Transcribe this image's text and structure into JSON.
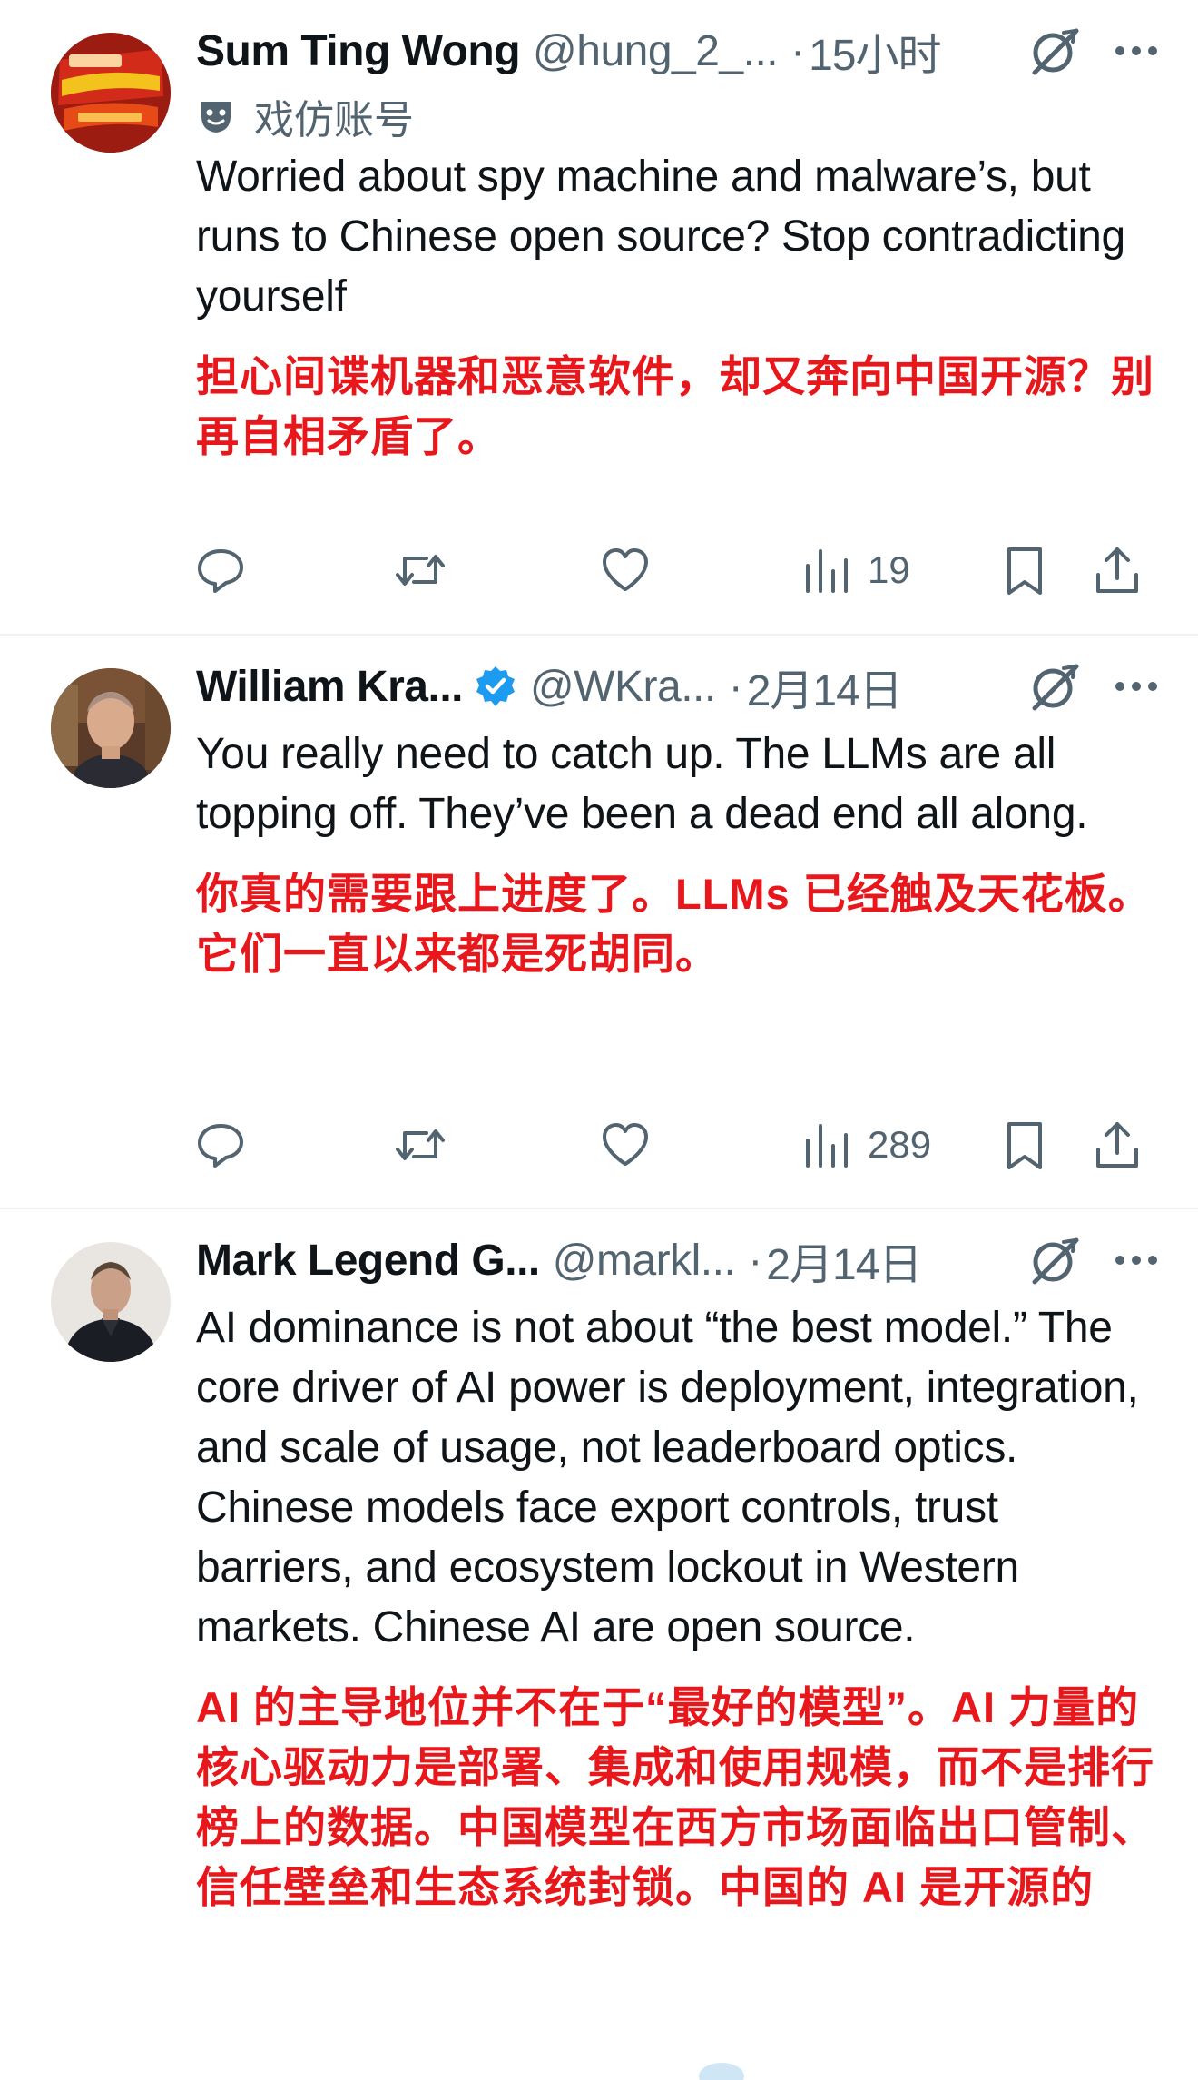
{
  "tweets": [
    {
      "name": "Sum Ting Wong",
      "handle": "@hung_2_...",
      "separator": "·",
      "time": "15小时",
      "verified": false,
      "parody_label": "戏仿账号",
      "text_en": "Worried about spy machine and malware’s, but runs to Chinese open source? Stop contradicting yourself",
      "text_zh": "担心间谍机器和恶意软件，却又奔向中国开源？别再自相矛盾了。",
      "views": "19"
    },
    {
      "name": "William Kra...",
      "handle": "@WKra...",
      "separator": "·",
      "time": "2月14日",
      "verified": true,
      "text_en": "You really need to catch up. The LLMs are all topping off. They’ve been a dead end all along.",
      "text_zh": "你真的需要跟上进度了。LLMs 已经触及天花板。它们一直以来都是死胡同。",
      "views": "289"
    },
    {
      "name": "Mark Legend G...",
      "handle": "@markl...",
      "separator": "·",
      "time": "2月14日",
      "verified": false,
      "text_en": "AI dominance is not about “the best model.” The core driver of AI power is deployment, integration, and scale of usage, not leaderboard optics. Chinese models face export controls, trust barriers, and ecosystem lockout in Western markets. Chinese AI are open source.",
      "text_zh": "AI 的主导地位并不在于“最好的模型”。AI 力量的核心驱动力是部署、集成和使用规模，而不是排行榜上的数据。中国模型在西方市场面临出口管制、信任壁垒和生态系统封锁。中国的 AI 是开源的"
    }
  ],
  "icons": {
    "reply": "reply-icon",
    "retweet": "retweet-icon",
    "like": "heart-icon",
    "views": "views-icon",
    "bookmark": "bookmark-icon",
    "share": "share-icon",
    "grok": "grok-icon",
    "more": "more-icon",
    "parody": "parody-mask-icon",
    "verified": "verified-badge-icon"
  },
  "colors": {
    "text": "#0f1419",
    "secondary": "#536471",
    "translation": "#e8171b",
    "verified": "#1d9bf0",
    "divider": "#eff3f4"
  }
}
